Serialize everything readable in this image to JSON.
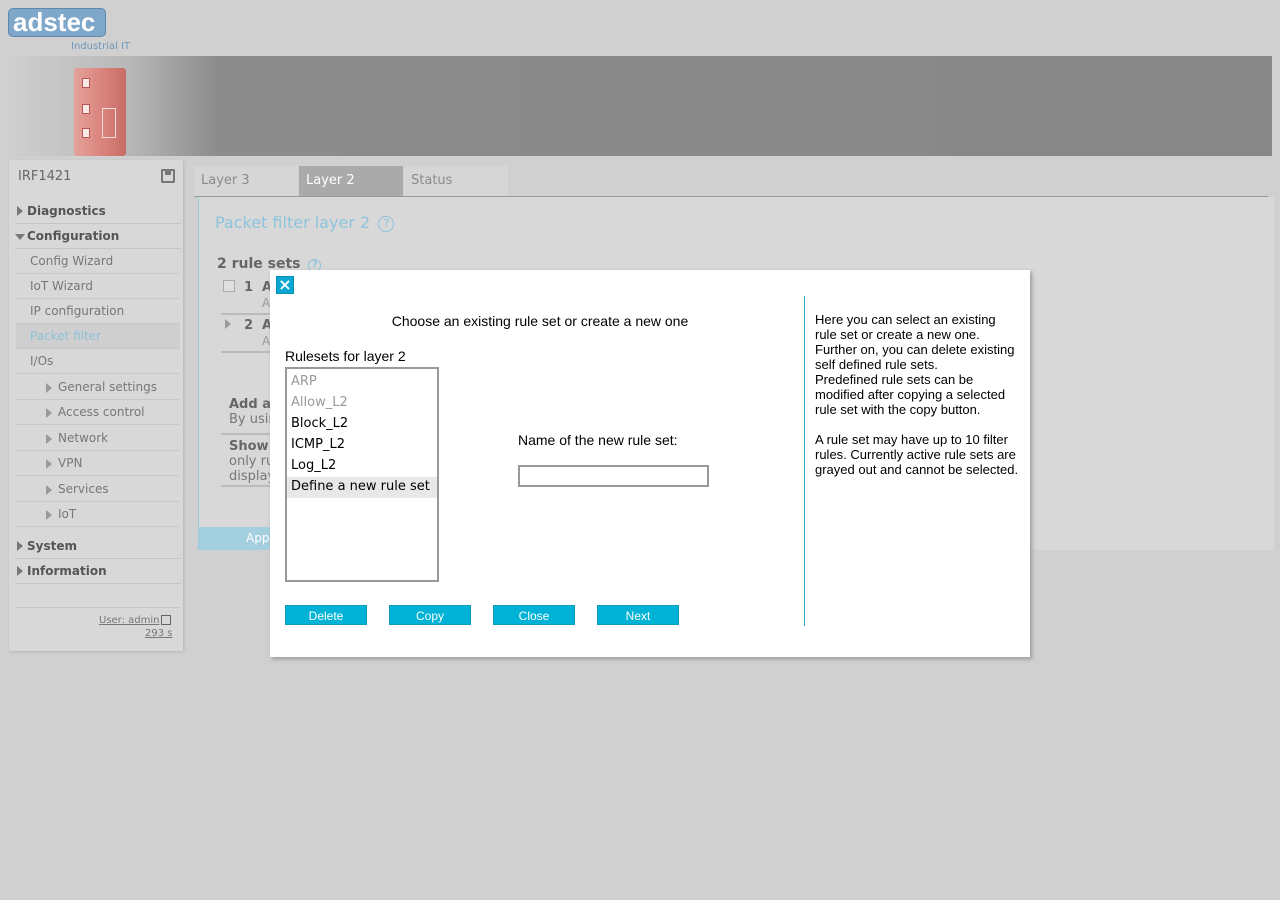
{
  "brand": {
    "logo_text": "adstec",
    "tagline": "Industrial IT"
  },
  "sidebar": {
    "device_name": "IRF1421",
    "sections": [
      {
        "label": "Diagnostics"
      },
      {
        "label": "Configuration"
      },
      {
        "label": "System"
      },
      {
        "label": "Information"
      }
    ],
    "config_items": [
      "Config Wizard",
      "IoT Wizard",
      "IP configuration",
      "Packet filter",
      "I/Os"
    ],
    "io_items": [
      "General settings",
      "Access control",
      "Network",
      "VPN",
      "Services",
      "IoT"
    ],
    "user_label": "User: admin",
    "session_timer": "293 s"
  },
  "tabs": [
    "Layer 3",
    "Layer 2",
    "Status"
  ],
  "active_tab": "Layer 2",
  "main": {
    "title": "Packet filter layer 2",
    "ruleset_count": "2 rule sets",
    "rows": [
      {
        "num": "1",
        "name": "A",
        "sub": "A"
      },
      {
        "num": "2",
        "name": "A",
        "sub": "A"
      }
    ],
    "add_title": "Add a",
    "add_text": "By usin",
    "show_title": "Show",
    "show_text1": "only ru",
    "show_text2": "display",
    "apply_label": "Appl"
  },
  "dialog": {
    "heading": "Choose an existing rule set or create a new one",
    "list_label": "Rulesets for layer 2",
    "rulesets": [
      {
        "label": "ARP",
        "disabled": true
      },
      {
        "label": "Allow_L2",
        "disabled": true
      },
      {
        "label": "Block_L2",
        "disabled": false
      },
      {
        "label": "ICMP_L2",
        "disabled": false
      },
      {
        "label": "Log_L2",
        "disabled": false
      },
      {
        "label": "Define a new rule set",
        "selected": true
      }
    ],
    "name_label": "Name of the new rule set:",
    "name_value": "",
    "buttons": {
      "delete": "Delete",
      "copy": "Copy",
      "close": "Close",
      "next": "Next"
    },
    "help_text": "Here you can select an existing rule set or create a new one. Further on, you can delete existing self defined rule sets.\nPredefined rule sets can be modified after copying a selected rule set with the copy button.\n\nA rule set may have up to 10 filter rules. Currently active rule sets are grayed out and cannot be selected."
  },
  "colors": {
    "accent": "#00b2d6",
    "title_blue": "#8cc4db",
    "brand_blue": "#7fa7c9"
  }
}
